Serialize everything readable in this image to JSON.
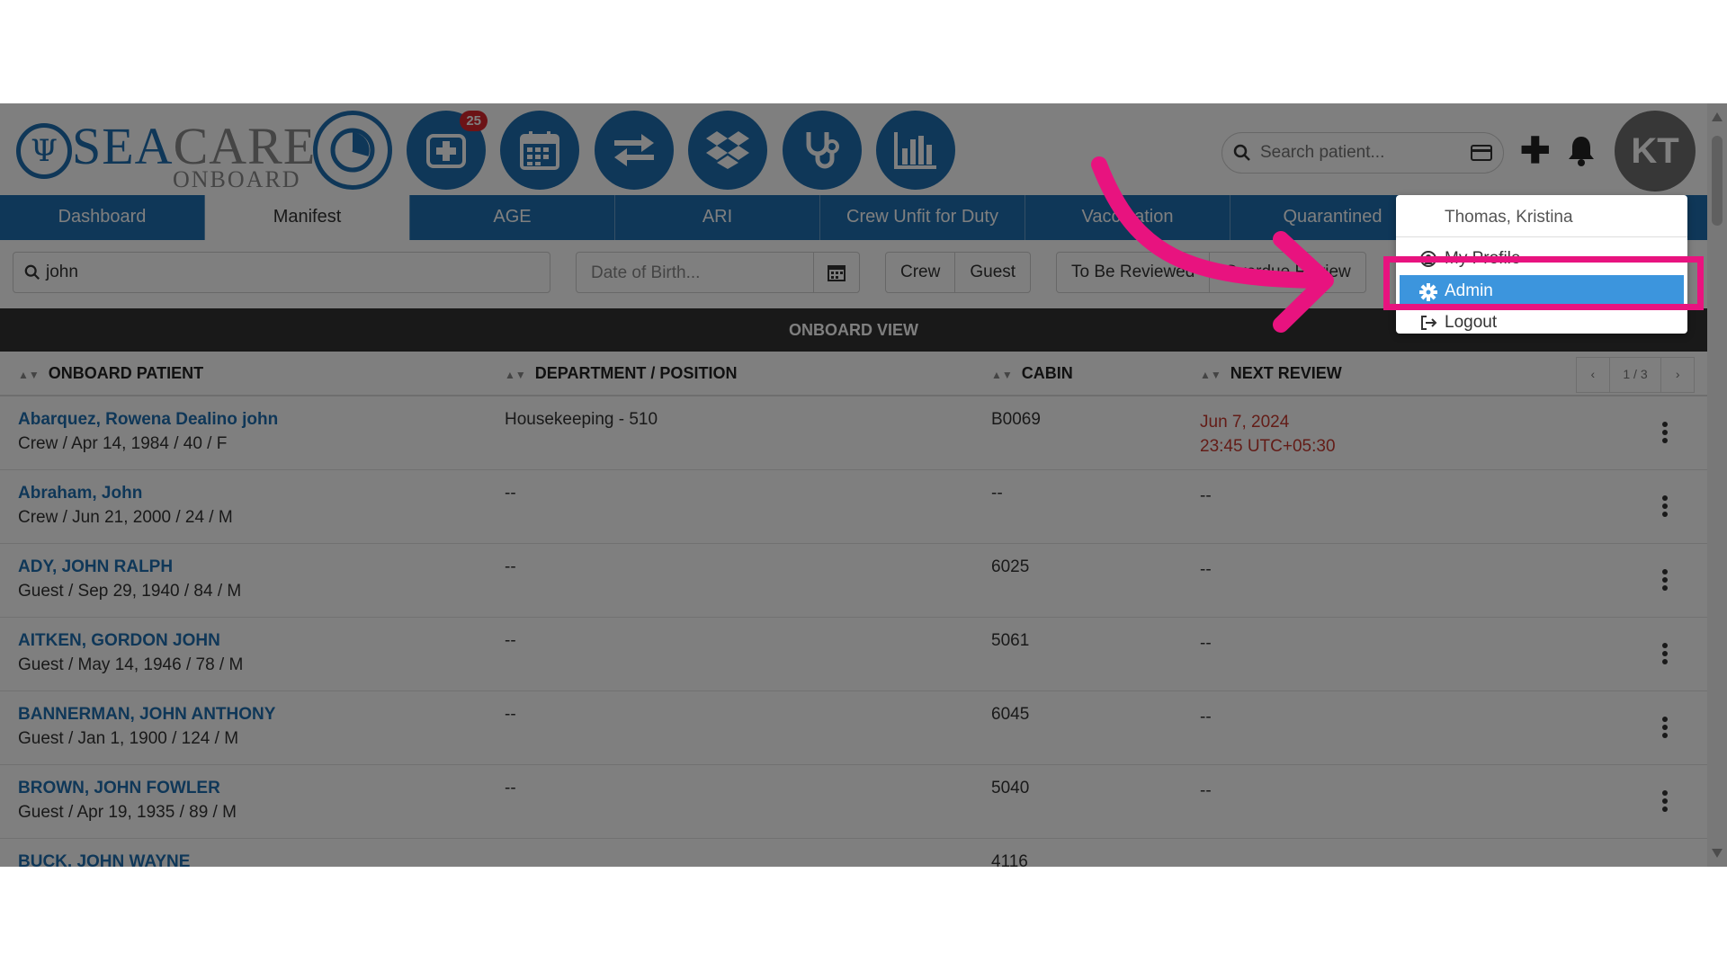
{
  "header": {
    "logo": {
      "sea": "SEA",
      "care": "CARE",
      "onboard": "ONBOARD"
    },
    "nav_icons": [
      "dashboard-icon",
      "add-medical-icon",
      "calendar-icon",
      "transfer-icon",
      "dropbox-icon",
      "stethoscope-icon",
      "bar-chart-icon"
    ],
    "badge_count": "25",
    "search_placeholder": "Search patient...",
    "avatar_initials": "KT"
  },
  "tabs": [
    "Dashboard",
    "Manifest",
    "AGE",
    "ARI",
    "Crew Unfit for Duty",
    "Vaccination",
    "Quarantined"
  ],
  "filters": {
    "search_value": "john",
    "dob_placeholder": "Date of Birth...",
    "type_buttons": [
      "Crew",
      "Guest"
    ],
    "review_buttons": [
      "To Be Reviewed",
      "Overdue Review"
    ]
  },
  "view_title": "ONBOARD VIEW",
  "table": {
    "columns": [
      "ONBOARD PATIENT",
      "DEPARTMENT / POSITION",
      "CABIN",
      "NEXT REVIEW"
    ],
    "pager": {
      "prev": "‹",
      "page": "1 / 3",
      "next": "›"
    },
    "rows": [
      {
        "name": "Abarquez, Rowena Dealino john",
        "sub": "Crew / Apr 14, 1984 / 40 / F",
        "dept": "Housekeeping - 510",
        "cabin": "B0069",
        "review": "Jun 7, 2024",
        "review2": "23:45 UTC+05:30"
      },
      {
        "name": "Abraham, John",
        "sub": "Crew / Jun 21, 2000 / 24 / M",
        "dept": "--",
        "cabin": "--",
        "review": "--",
        "review2": ""
      },
      {
        "name": "ADY, JOHN RALPH",
        "sub": "Guest / Sep 29, 1940 / 84 / M",
        "dept": "--",
        "cabin": "6025",
        "review": "--",
        "review2": ""
      },
      {
        "name": "AITKEN, GORDON JOHN",
        "sub": "Guest / May 14, 1946 / 78 / M",
        "dept": "--",
        "cabin": "5061",
        "review": "--",
        "review2": ""
      },
      {
        "name": "BANNERMAN, JOHN ANTHONY",
        "sub": "Guest / Jan 1, 1900 / 124 / M",
        "dept": "--",
        "cabin": "6045",
        "review": "--",
        "review2": ""
      },
      {
        "name": "BROWN, JOHN FOWLER",
        "sub": "Guest / Apr 19, 1935 / 89 / M",
        "dept": "--",
        "cabin": "5040",
        "review": "--",
        "review2": ""
      },
      {
        "name": "BUCK, JOHN WAYNE",
        "sub": "",
        "dept": "",
        "cabin": "4116",
        "review": "",
        "review2": ""
      }
    ]
  },
  "user_menu": {
    "user_name": "Thomas, Kristina",
    "items": [
      {
        "label": "My Profile",
        "icon": "user-circle-icon"
      },
      {
        "label": "Admin",
        "icon": "gear-icon"
      },
      {
        "label": "Logout",
        "icon": "logout-icon"
      }
    ]
  },
  "colors": {
    "brand_blue": "#1f6fb0",
    "highlight_pink": "#e8137f",
    "active_item": "#3c95dd",
    "overdue_red": "#c6392f"
  }
}
